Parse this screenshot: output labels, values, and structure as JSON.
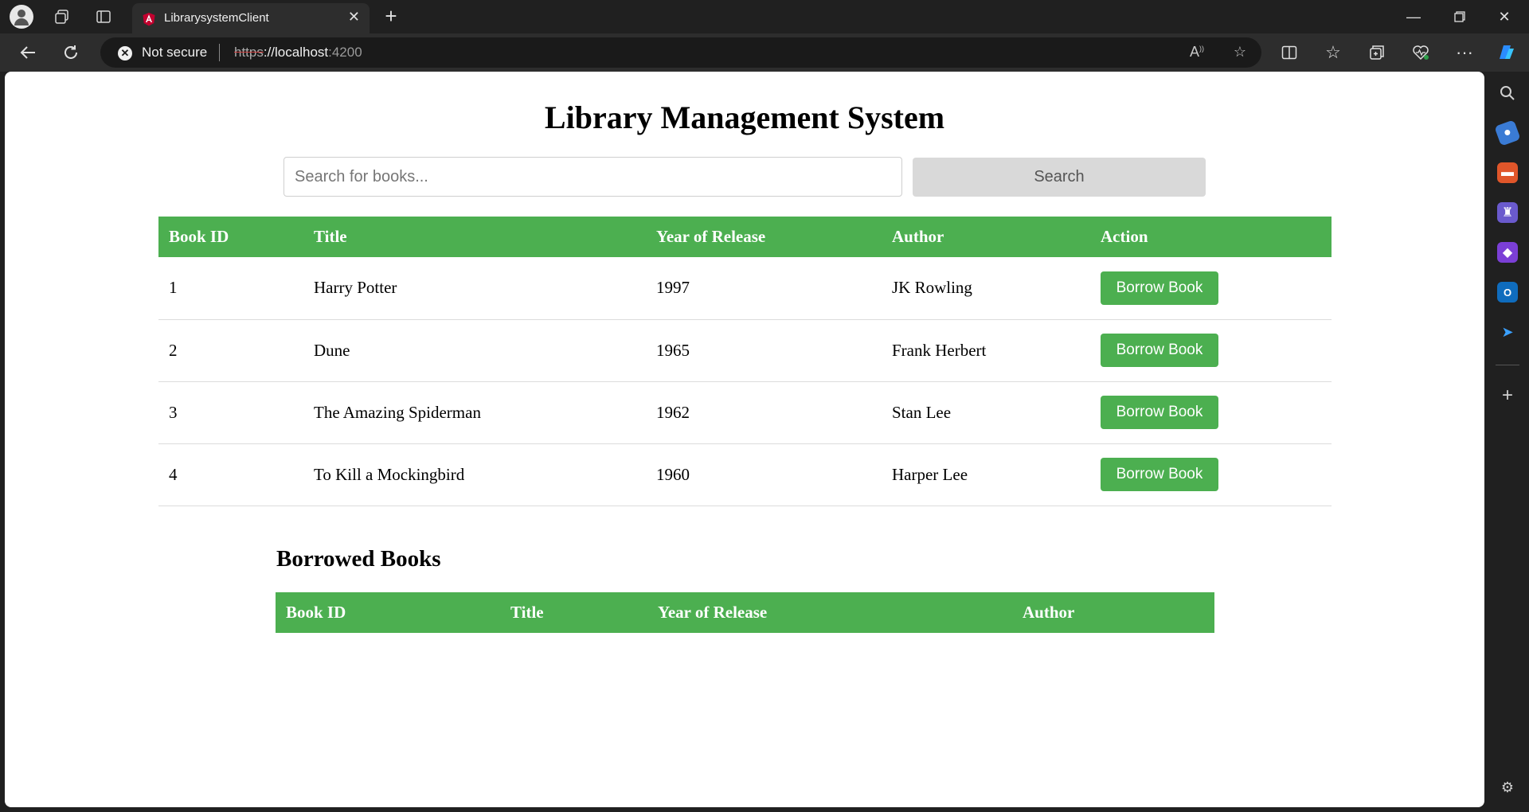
{
  "browser": {
    "tab_title": "LibrarysystemClient",
    "security_label": "Not secure",
    "url_scheme": "https",
    "url_host": "://localhost",
    "url_port": ":4200"
  },
  "page": {
    "title": "Library Management System",
    "search": {
      "placeholder": "Search for books...",
      "value": "",
      "button_label": "Search"
    },
    "books_table": {
      "headers": [
        "Book ID",
        "Title",
        "Year of Release",
        "Author",
        "Action"
      ],
      "rows": [
        {
          "id": "1",
          "title": "Harry Potter",
          "year": "1997",
          "author": "JK Rowling",
          "action": "Borrow Book"
        },
        {
          "id": "2",
          "title": "Dune",
          "year": "1965",
          "author": "Frank Herbert",
          "action": "Borrow Book"
        },
        {
          "id": "3",
          "title": "The Amazing Spiderman",
          "year": "1962",
          "author": "Stan Lee",
          "action": "Borrow Book"
        },
        {
          "id": "4",
          "title": "To Kill a Mockingbird",
          "year": "1960",
          "author": "Harper Lee",
          "action": "Borrow Book"
        }
      ]
    },
    "borrowed": {
      "title": "Borrowed Books",
      "headers": [
        "Book ID",
        "Title",
        "Year of Release",
        "Author"
      ]
    }
  },
  "colors": {
    "accent_green": "#4caf50",
    "search_button_bg": "#d9d9d9"
  }
}
